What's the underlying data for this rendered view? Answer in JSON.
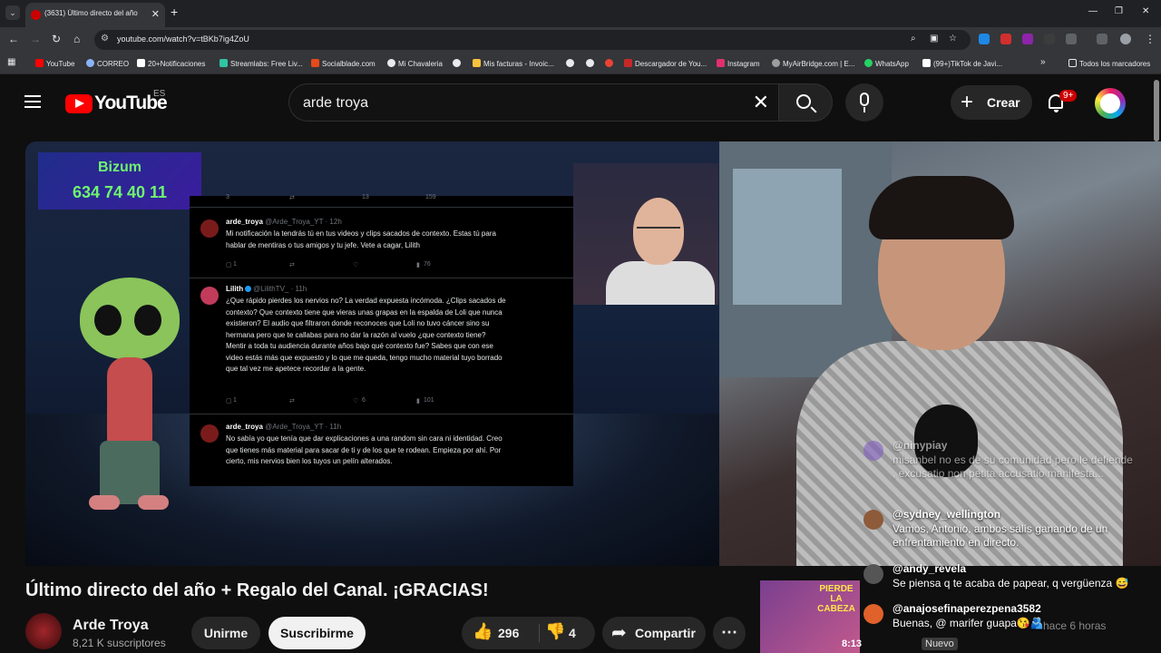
{
  "browser": {
    "tab_title": "(3631) Último directo del año",
    "url": "youtube.com/watch?v=tBKb7ig4ZoU",
    "bookmarks": [
      {
        "label": "YouTube",
        "color": "#ff0000"
      },
      {
        "label": "CORREO",
        "color": "#8ab4f8"
      },
      {
        "label": "20+Notificaciones",
        "color": "#ffffff"
      },
      {
        "label": "Streamlabs: Free Liv...",
        "color": "#31c3a2"
      },
      {
        "label": "Socialblade.com",
        "color": "#e64a19"
      },
      {
        "label": "Mi Chavaleria",
        "color": "#e8eaed"
      },
      {
        "label": "",
        "color": "#e8eaed"
      },
      {
        "label": "Mis facturas - Invoic...",
        "color": "#f9c23c"
      },
      {
        "label": "",
        "color": "#e8eaed"
      },
      {
        "label": "",
        "color": "#e8eaed"
      },
      {
        "label": "",
        "color": "#ea4335"
      },
      {
        "label": "Descargador de You...",
        "color": "#c62828"
      },
      {
        "label": "Instagram",
        "color": "#e1306c"
      },
      {
        "label": "MyAirBridge.com | E...",
        "color": "#9e9e9e"
      },
      {
        "label": "WhatsApp",
        "color": "#25d366"
      },
      {
        "label": "(99+)TikTok de Javi...",
        "color": "#ffffff"
      }
    ],
    "all_bookmarks": "Todos los marcadores"
  },
  "youtube": {
    "logo": "YouTube",
    "country": "ES",
    "search_query": "arde troya",
    "create_label": "Crear",
    "notif_badge": "9+"
  },
  "video": {
    "bizum_label": "Bizum",
    "bizum_number": "634 74 40 11",
    "tweet_counts_top": [
      "3",
      "13",
      "159"
    ],
    "tweets": [
      {
        "name": "arde_troya",
        "handle": "@Arde_Troya_YT · 12h",
        "text": "Mi notificación la tendrás tú en tus videos y clips sacados de contexto. Estas tú para hablar de mentiras o tus amigos y tu jefe. Vete a cagar, Lilith",
        "reply": "1",
        "like": "",
        "views": "76"
      },
      {
        "name": "Lilith",
        "handle": "@LilithTV_ · 11h",
        "text": "¿Que rápido pierdes los nervios no? La verdad expuesta incómoda. ¿Clips sacados de contexto? Que contexto tiene que vieras unas grapas en la espalda de Loli que nunca existieron? El audio que filtraron donde reconoces que Loli no tuvo cáncer sino su hermana pero que te callabas para no dar la razón al vuelo ¿que contexto tiene? Mentir a toda tu audiencia durante años bajo qué contexto fue? Sabes que con ese video estás más que expuesto y lo que me queda, tengo mucho material tuyo borrado que tal vez me apetece recordar a la gente.",
        "reply": "1",
        "like": "6",
        "views": "101"
      },
      {
        "name": "arde_troya",
        "handle": "@Arde_Troya_YT · 11h",
        "text": "No sabía yo que tenía que dar explicaciones a una random sin cara ni identidad. Creo que tienes más material para sacar de ti y de los que te rodean. Empieza por ahí. Por cierto, mis nervios bien los tuyos un pelín alterados.",
        "reply": "",
        "like": "",
        "views": ""
      }
    ],
    "chat": [
      {
        "user": "@ninypiay",
        "msg": "misanbel no es de su comunidad pero le defiende , excusatio non petita accusatio manifesta..."
      },
      {
        "user": "@sydney_wellington",
        "msg": "Vamos, Antonio, ambos salís ganando de un enfrentamiento en directo."
      },
      {
        "user": "@andy_revela",
        "msg": "Se piensa q te acaba de papear, q vergüenza 😅"
      },
      {
        "user": "@anajosefinaperezpena3582",
        "msg": "Buenas, @ marifer guapa😘🫂"
      }
    ],
    "overlay_thumb_title": "PIERDE LA CABEZA",
    "overlay_thumb_duration": "8:13",
    "overlay_ago": "hace 6 horas",
    "nuevo_label": "Nuevo"
  },
  "details": {
    "title": "Último directo del año + Regalo del Canal. ¡GRACIAS!",
    "channel": "Arde Troya",
    "subscribers": "8,21 K suscriptores",
    "join_label": "Unirme",
    "subscribe_label": "Suscribirme",
    "likes": "296",
    "dislikes": "4",
    "share_label": "Compartir"
  }
}
